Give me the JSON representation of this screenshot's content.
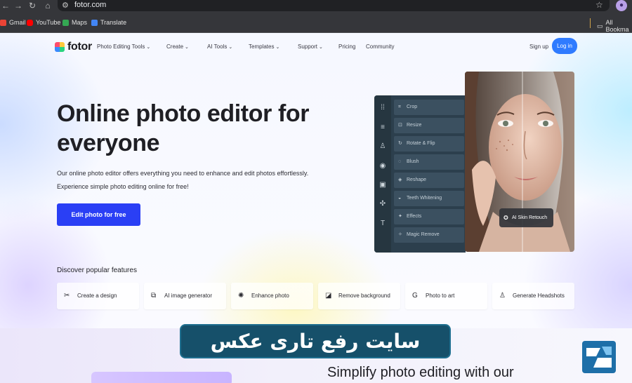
{
  "browser": {
    "url": "fotor.com",
    "bookmarks": [
      "Gmail",
      "YouTube",
      "Maps",
      "Translate"
    ],
    "all_bookmarks": "All Bookma"
  },
  "nav": {
    "logo": "fotor",
    "items": [
      "Photo Editing Tools",
      "Create",
      "AI Tools",
      "Templates",
      "Support",
      "Pricing",
      "Community"
    ],
    "signup": "Sign up",
    "login": "Log in"
  },
  "hero": {
    "title": "Online photo editor for everyone",
    "desc_line1": "Our online photo editor offers everything you need to enhance and edit photos effortlessly.",
    "desc_line2": "Experience simple photo editing online for free!",
    "cta": "Edit photo for free"
  },
  "editor": {
    "tools": [
      "Crop",
      "Resize",
      "Rotate & Flip",
      "Blush",
      "Reshape",
      "Teeth Whitening",
      "Effects",
      "Magic Remove"
    ],
    "badge": "AI Skin Retouch"
  },
  "features": {
    "title": "Discover popular features",
    "items": [
      "Create a design",
      "AI image generator",
      "Enhance photo",
      "Remove background",
      "Photo to art",
      "Generate Headshots"
    ]
  },
  "band": {
    "heading": "Simplify photo editing with our"
  },
  "overlay": {
    "text": "سایت رفع تاری عکس"
  },
  "colors": {
    "accent": "#2a3ff5",
    "login": "#2f7bff",
    "banner": "#16506a"
  }
}
